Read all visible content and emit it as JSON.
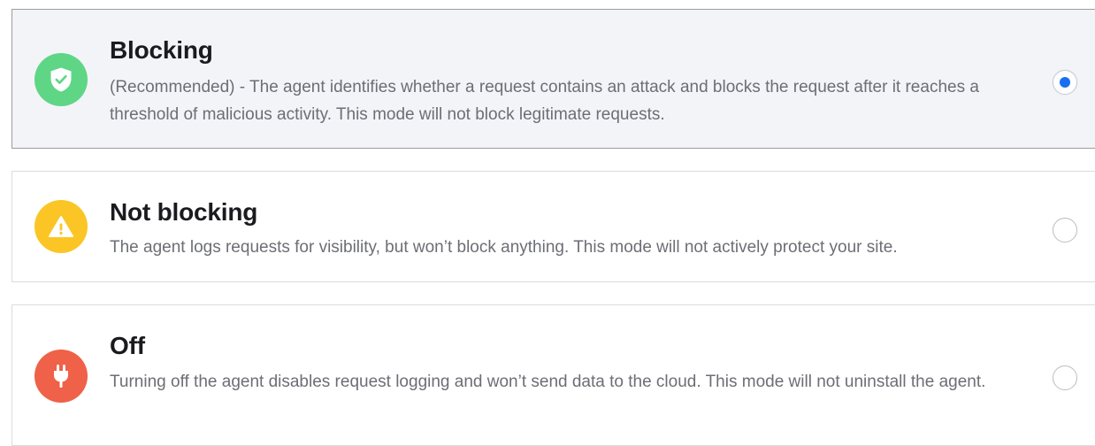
{
  "colors": {
    "shield_green": "#5ed685",
    "warning_yellow": "#fbc625",
    "off_red": "#ef6148",
    "radio_selected": "#1a6ff0",
    "title_text": "#1a1a1f",
    "desc_text": "#6d6e75",
    "selected_bg": "#f3f4f8"
  },
  "options": [
    {
      "id": "blocking",
      "icon": "shield-check-icon",
      "title": "Blocking",
      "description": "(Recommended) - The agent identifies whether a request contains an attack and blocks the request after it reaches a threshold of malicious activity. This mode will not block legitimate requests.",
      "selected": true
    },
    {
      "id": "not-blocking",
      "icon": "warning-triangle-icon",
      "title": "Not blocking",
      "description": "The agent logs requests for visibility, but won’t block anything. This mode will not actively protect your site.",
      "selected": false
    },
    {
      "id": "off",
      "icon": "plug-icon",
      "title": "Off",
      "description": "Turning off the agent disables request logging and won’t send data to the cloud. This mode will not uninstall the agent.",
      "selected": false
    }
  ]
}
